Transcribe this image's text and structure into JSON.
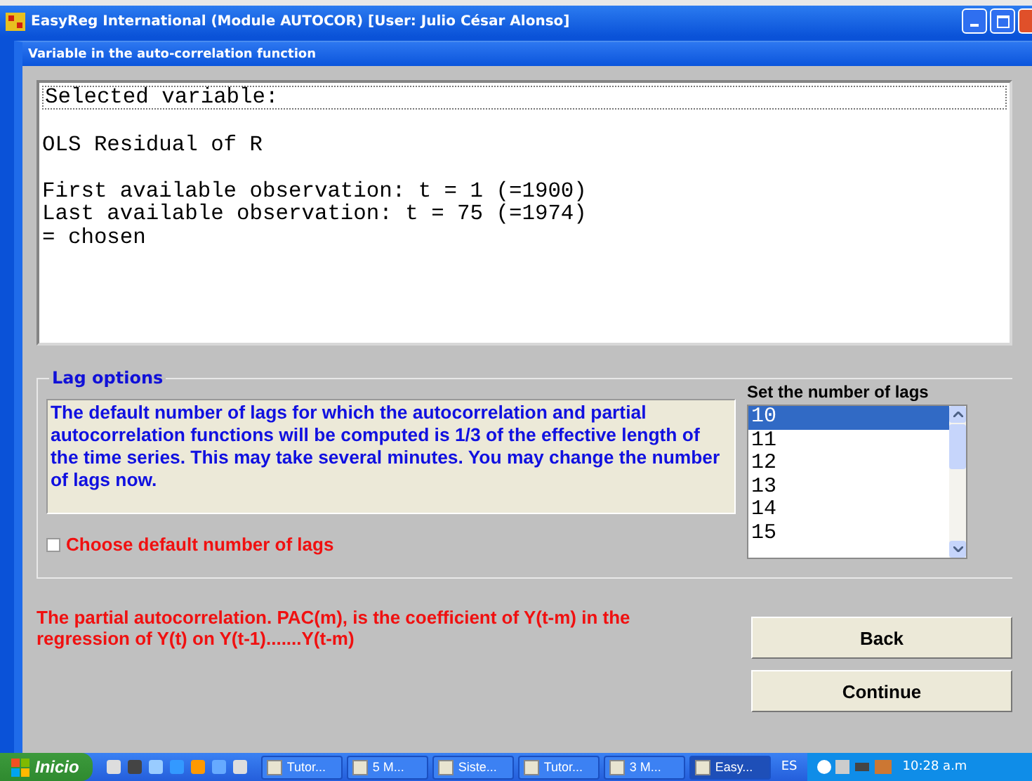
{
  "window": {
    "title": "EasyReg International (Module AUTOCOR) [User: Julio César Alonso]"
  },
  "dialog": {
    "title": "Variable in the auto-correlation function"
  },
  "info_text": {
    "blocks": [
      [
        "Selected variable:"
      ],
      [
        "OLS Residual of R"
      ],
      [
        "First available observation: t = 1 (=1900)",
        "Last available observation: t = 75 (=1974)",
        "= chosen"
      ]
    ]
  },
  "lag_options": {
    "title": "Lag options",
    "description": "The default number of lags for which the autocorrelation and partial autocorrelation functions will be computed is 1/3 of the effective length of the time series. This may take several minutes. You may change the number of lags now.",
    "checkbox": {
      "label": "Choose default number of lags",
      "checked": false
    },
    "list_label": "Set the number of lags",
    "lags": [
      {
        "label": "10",
        "selected": true
      },
      {
        "label": "11",
        "selected": false
      },
      {
        "label": "12",
        "selected": false
      },
      {
        "label": "13",
        "selected": false
      },
      {
        "label": "14",
        "selected": false
      },
      {
        "label": "15",
        "selected": false
      }
    ]
  },
  "note": "The partial autocorrelation. PAC(m), is the coefficient of Y(t-m) in the regression of Y(t) on Y(t-1).......Y(t-m)",
  "buttons": [
    "Back",
    "Continue"
  ],
  "taskbar": {
    "start": "Inicio",
    "tasks": [
      {
        "label": "Tutor...",
        "selected": false
      },
      {
        "label": "5 M...",
        "selected": false
      },
      {
        "label": "Siste...",
        "selected": false
      },
      {
        "label": "Tutor...",
        "selected": false
      },
      {
        "label": "3 M...",
        "selected": false
      },
      {
        "label": "Easy...",
        "selected": true
      }
    ],
    "language": "ES",
    "clock": "10:28 a.m"
  }
}
